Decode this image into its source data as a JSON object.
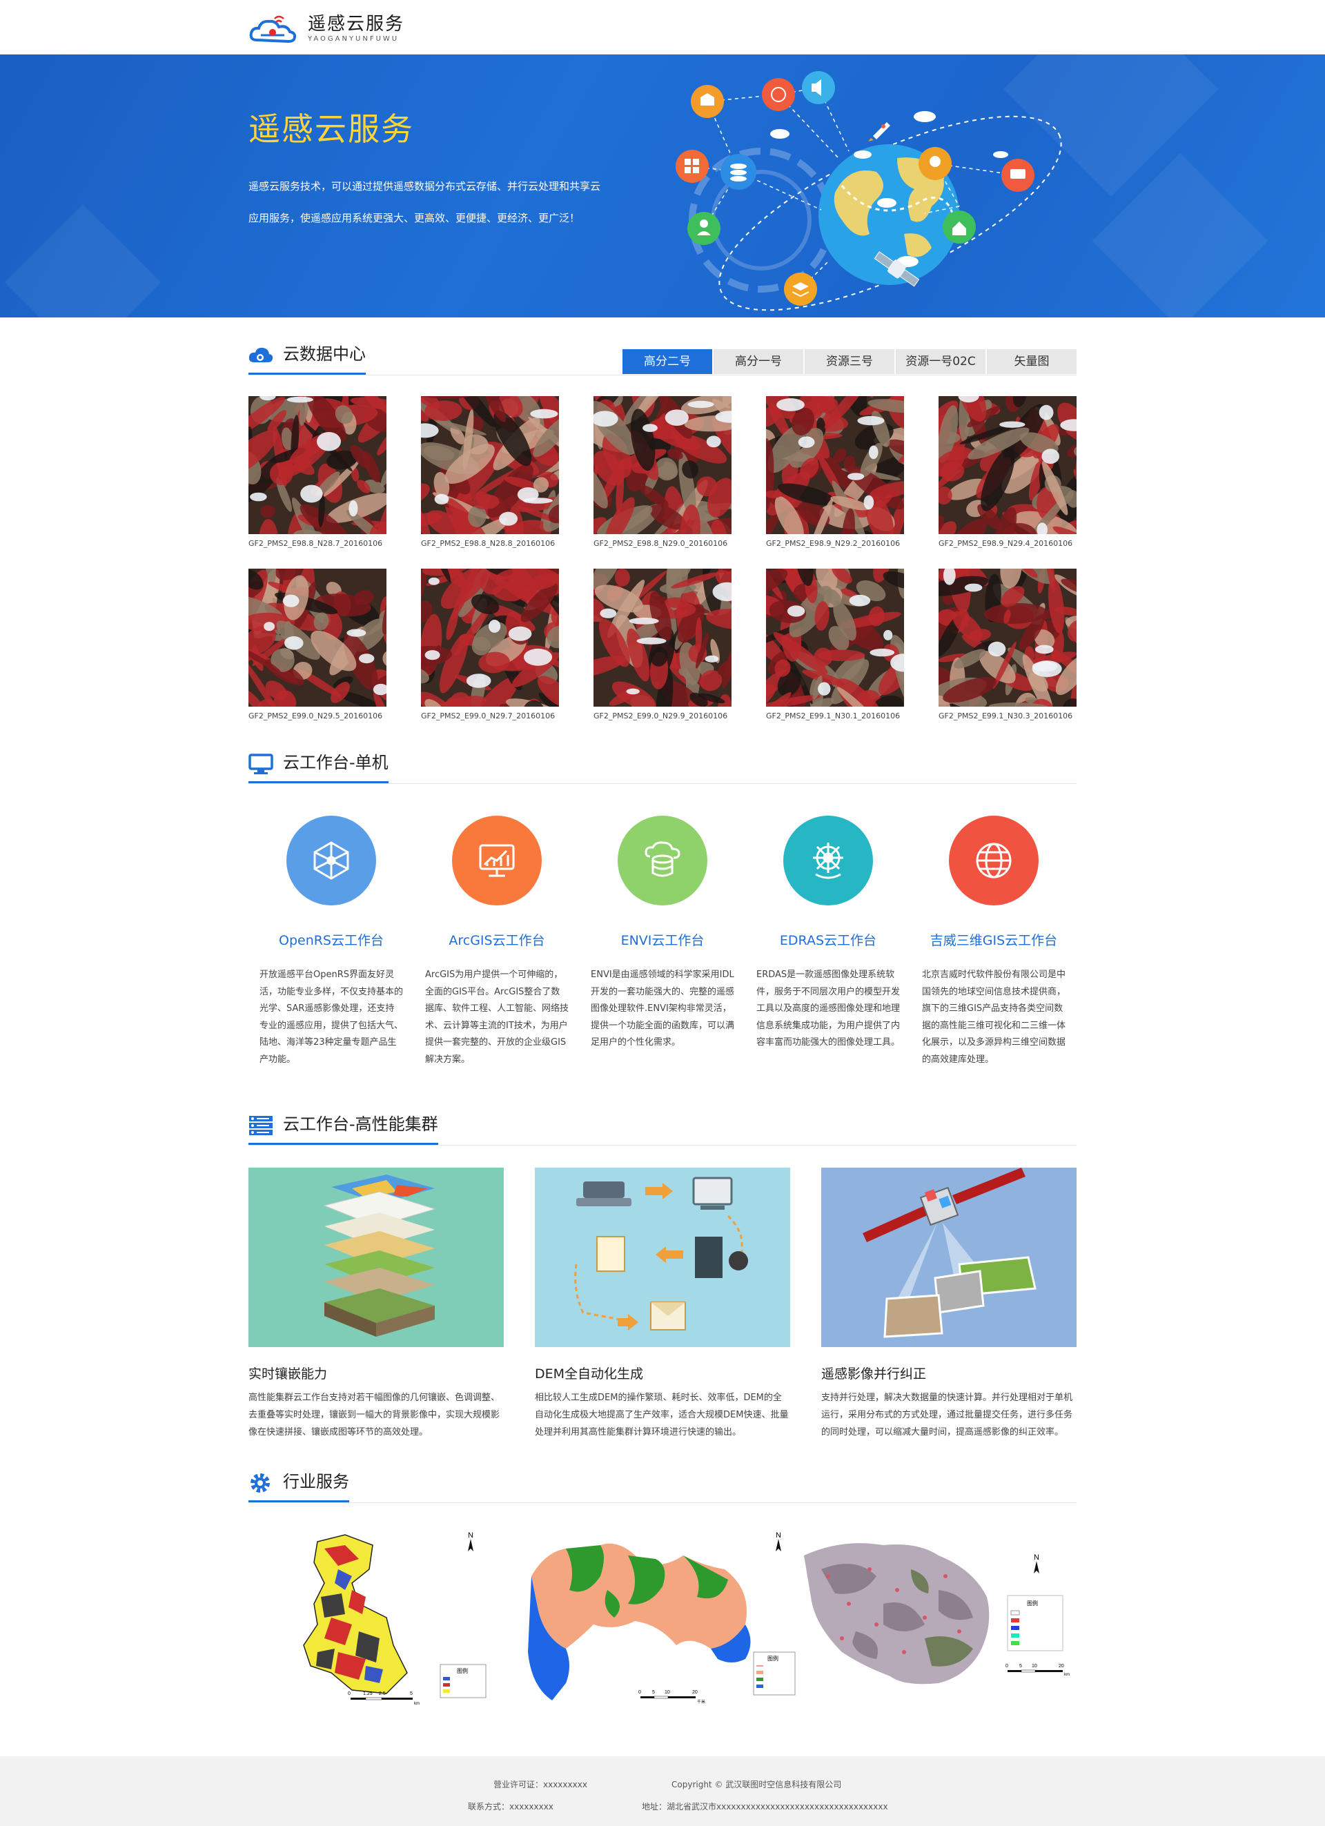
{
  "header": {
    "logo_title": "遥感云服务",
    "logo_sub": "YAOGANYUNFUWU"
  },
  "banner": {
    "title": "遥感云服务",
    "desc": "遥感云服务技术，可以通过提供遥感数据分布式云存储、并行云处理和共享云应用服务，使遥感应用系统更强大、更高效、更便捷、更经济、更广泛！"
  },
  "data_center": {
    "title": "云数据中心",
    "tabs": [
      "高分二号",
      "高分一号",
      "资源三号",
      "资源一号02C",
      "矢量图"
    ],
    "active_tab": 0,
    "images": [
      {
        "caption": "GF2_PMS2_E98.8_N28.7_20160106"
      },
      {
        "caption": "GF2_PMS2_E98.8_N28.8_20160106"
      },
      {
        "caption": "GF2_PMS2_E98.8_N29.0_20160106"
      },
      {
        "caption": "GF2_PMS2_E98.9_N29.2_20160106"
      },
      {
        "caption": "GF2_PMS2_E98.9_N29.4_20160106"
      },
      {
        "caption": "GF2_PMS2_E99.0_N29.5_20160106"
      },
      {
        "caption": "GF2_PMS2_E99.0_N29.7_20160106"
      },
      {
        "caption": "GF2_PMS2_E99.0_N29.9_20160106"
      },
      {
        "caption": "GF2_PMS2_E99.1_N30.1_20160106"
      },
      {
        "caption": "GF2_PMS2_E99.1_N30.3_20160106"
      }
    ]
  },
  "workstation": {
    "title": "云工作台-单机",
    "items": [
      {
        "name": "OpenRS云工作台",
        "icon": "network-icon",
        "color": "#5b9ee8",
        "desc": "开放遥感平台OpenRS界面友好灵活，功能专业多样，不仅支持基本的光学、SAR遥感影像处理，还支持专业的遥感应用，提供了包括大气、陆地、海洋等23种定量专题产品生产功能。"
      },
      {
        "name": "ArcGIS云工作台",
        "icon": "chart-monitor-icon",
        "color": "#f9793c",
        "desc": "ArcGIS为用户提供一个可伸缩的，全面的GIS平台。ArcGIS整合了数据库、软件工程、人工智能、网络技术、云计算等主流的IT技术，为用户提供一套完整的、开放的企业级GIS解决方案。"
      },
      {
        "name": "ENVI云工作台",
        "icon": "cloud-database-icon",
        "color": "#8fd16a",
        "desc": "ENVI是由遥感领域的科学家采用IDL开发的一套功能强大的、完整的遥感图像处理软件.ENVI架构非常灵活，提供一个功能全面的函数库，可以满足用户的个性化需求。"
      },
      {
        "name": "EDRAS云工作台",
        "icon": "helm-icon",
        "color": "#27b6c4",
        "desc": "ERDAS是一款遥感图像处理系统软件，服务于不同层次用户的模型开发工具以及高度的遥感图像处理和地理信息系统集成功能，为用户提供了内容丰富而功能强大的图像处理工具。"
      },
      {
        "name": "吉威三维GIS云工作台",
        "icon": "globe-icon",
        "color": "#f0533f",
        "desc": "北京吉威时代软件股份有限公司是中国领先的地球空间信息技术提供商，旗下的三维GIS产品支持各类空间数据的高性能三维可视化和二三维一体化展示，以及多源异构三维空间数据的高效建库处理。"
      }
    ]
  },
  "cluster": {
    "title": "云工作台-高性能集群",
    "items": [
      {
        "title": "实时镶嵌能力",
        "desc": "高性能集群云工作台支持对若干幅图像的几何镶嵌、色调调整、去重叠等实时处理，镶嵌到一幅大的背景影像中，实现大规模影像在快速拼接、镶嵌成图等环节的高效处理。"
      },
      {
        "title": "DEM全自动化生成",
        "desc": "相比较人工生成DEM的操作繁琐、耗时长、效率低，DEM的全自动化生成极大地提高了生产效率，适合大规模DEM快速、批量处理并利用其高性能集群计算环境进行快速的输出。"
      },
      {
        "title": "遥感影像并行纠正",
        "desc": "支持并行处理，解决大数据量的快速计算。并行处理相对于单机运行，采用分布式的方式处理，通过批量提交任务，进行多任务的同时处理，可以缩减大量时间，提高遥感影像的纠正效率。"
      }
    ]
  },
  "industry": {
    "title": "行业服务",
    "maps": [
      {
        "legend_title": "图例",
        "legend": [
          "",
          ""
        ],
        "scale": [
          "0",
          "1.25",
          "2.5",
          "",
          "5"
        ],
        "unit": "km"
      },
      {
        "legend_title": "图例",
        "legend": [
          "",
          "",
          "",
          ""
        ],
        "scale": [
          "0",
          "5",
          "10",
          "",
          "20"
        ],
        "unit": "千米"
      },
      {
        "legend_title": "图例",
        "legend": [
          "",
          "",
          "",
          "",
          ""
        ],
        "scale": [
          "0",
          "5",
          "10",
          "",
          "20"
        ],
        "unit": "km"
      }
    ]
  },
  "footer": {
    "license": "营业许可证：xxxxxxxxx",
    "copyright": "Copyright © 武汉联图时空信息科技有限公司",
    "contact": "联系方式：xxxxxxxxx",
    "address": "地址：湖北省武汉市xxxxxxxxxxxxxxxxxxxxxxxxxxxxxxxxxxx"
  }
}
